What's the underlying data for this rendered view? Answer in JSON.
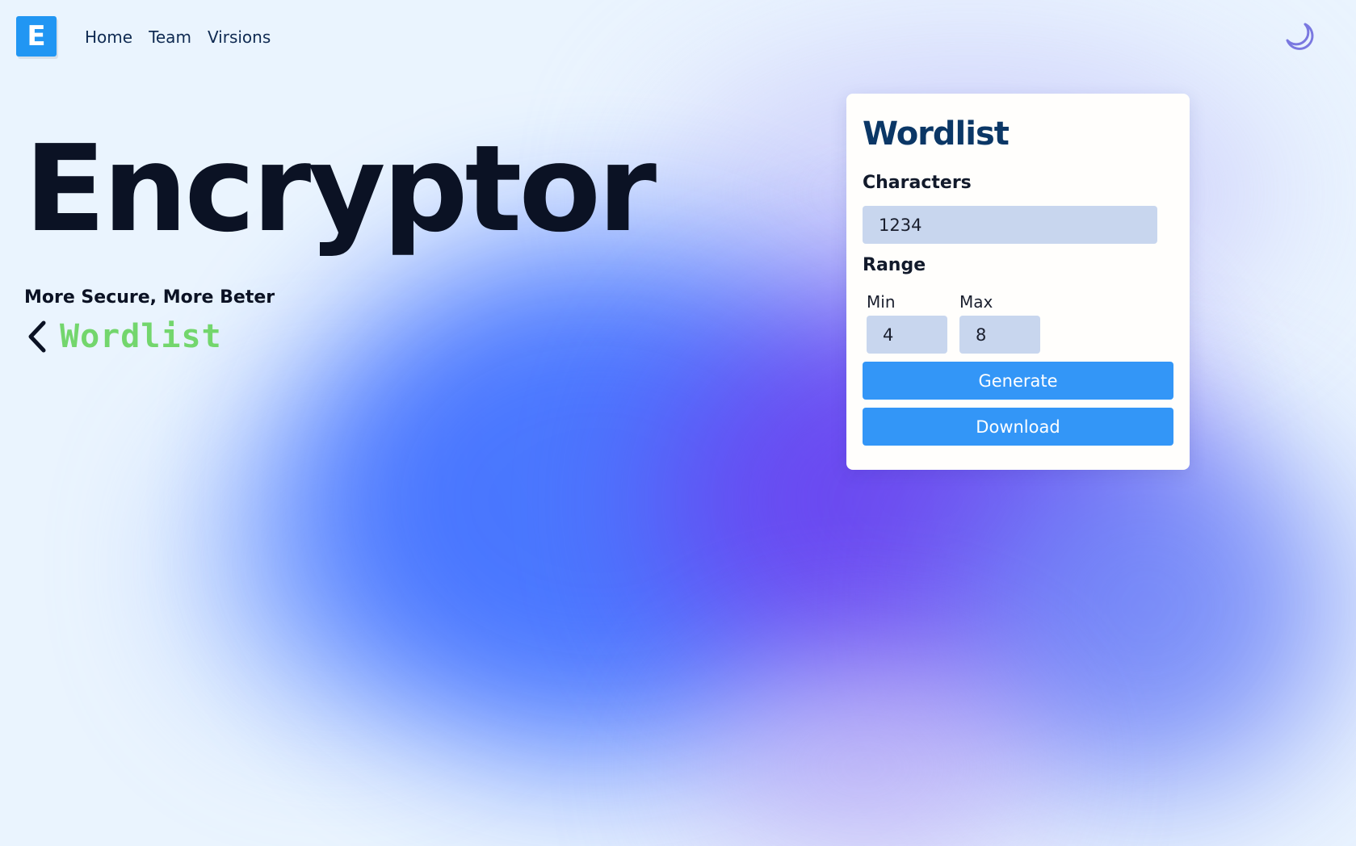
{
  "header": {
    "logo_letter": "E",
    "nav": [
      {
        "label": "Home"
      },
      {
        "label": "Team"
      },
      {
        "label": "Virsions"
      }
    ],
    "theme_toggle_icon": "moon-icon"
  },
  "hero": {
    "title": "Encryptor",
    "subtitle": "More Secure, More Beter",
    "back_icon": "chevron-left-icon",
    "back_label": "Wordlist"
  },
  "card": {
    "title": "Wordlist",
    "characters_label": "Characters",
    "characters_value": "1234",
    "range_label": "Range",
    "min_label": "Min",
    "min_value": "4",
    "max_label": "Max",
    "max_value": "8",
    "generate_label": "Generate",
    "download_label": "Download"
  },
  "colors": {
    "accent": "#3396f7",
    "logo_bg": "#2196f3",
    "back_label": "#73d66d",
    "card_title": "#0b3766",
    "moon": "#7a78e0"
  }
}
